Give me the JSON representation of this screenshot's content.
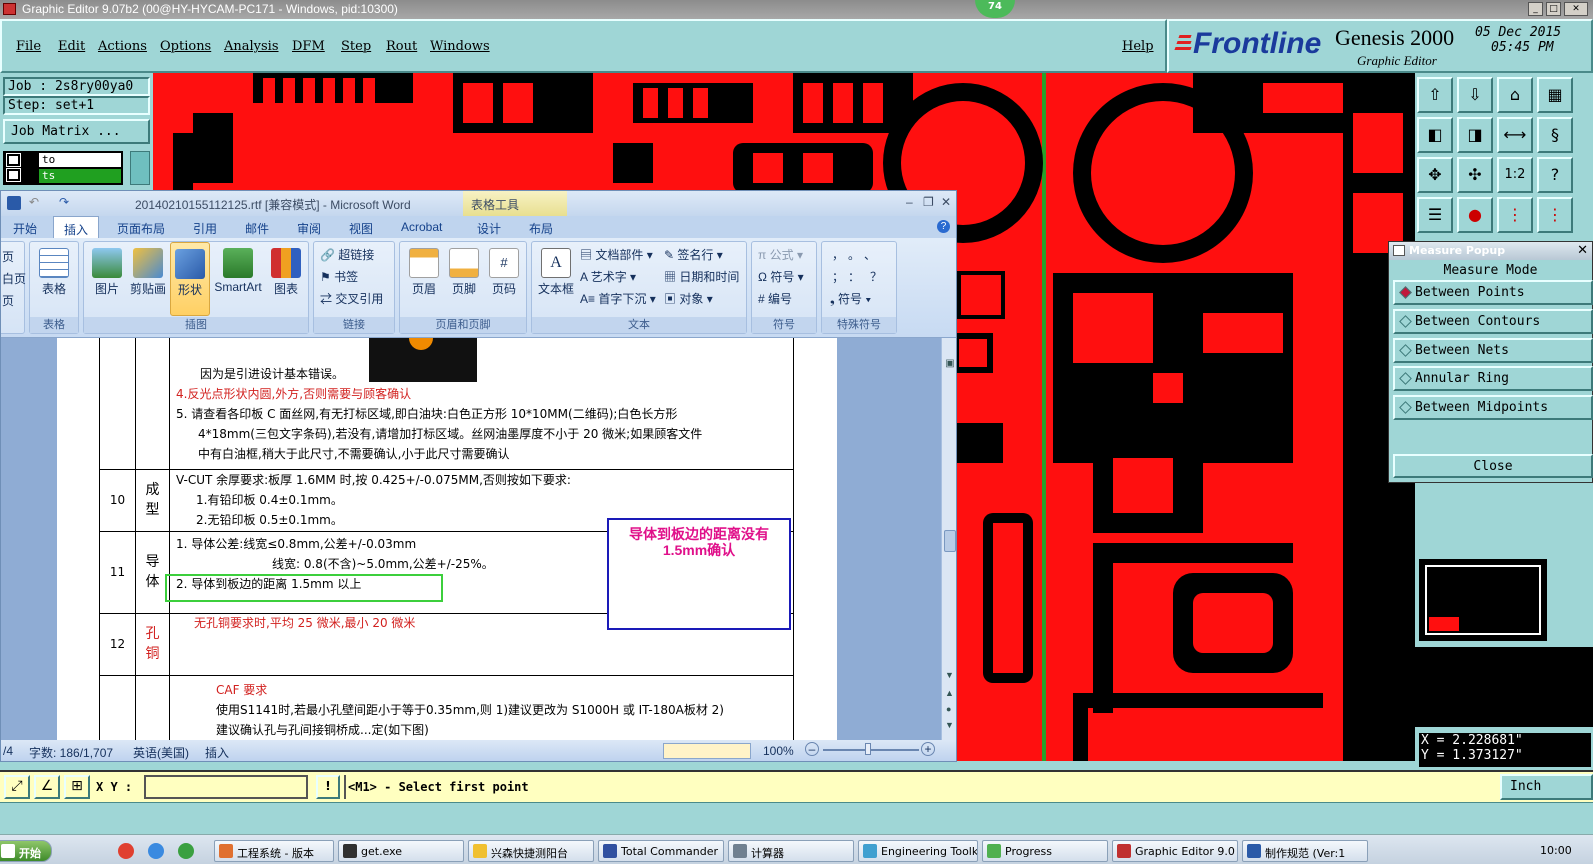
{
  "titlebar": {
    "title": "Graphic Editor 9.07b2 (00@HY-HYCAM-PC171 - Windows, pid:10300)",
    "badge": "74"
  },
  "menu": {
    "items": [
      "File",
      "Edit",
      "Actions",
      "Options",
      "Analysis",
      "DFM",
      "Step",
      "Rout",
      "Windows"
    ],
    "help": "Help"
  },
  "brand": {
    "logo": "Frontline",
    "product": "Genesis 2000",
    "subtitle": "Graphic Editor",
    "date": "05 Dec 2015",
    "time": "05:45 PM"
  },
  "job": {
    "job": "Job : 2s8ry00ya0",
    "step": "Step: set+1",
    "matrix_button": "Job Matrix ...",
    "layers": [
      "to",
      "ts"
    ]
  },
  "measure": {
    "title": "Measure Popup",
    "heading": "Measure Mode",
    "modes": [
      "Between Points",
      "Between Contours",
      "Between Nets",
      "Annular Ring",
      "Between Midpoints"
    ],
    "selected_mode": "Between Points",
    "close": "Close"
  },
  "coords": {
    "x": "X = 2.228681\"",
    "y": "Y = 1.373127\""
  },
  "command": {
    "xy_label": "X Y :",
    "xy_value": "",
    "prompt": "<M1> - Select first point",
    "units": "Inch"
  },
  "word": {
    "title": "20140210155112125.rtf [兼容模式] - Microsoft Word",
    "context_tools": "表格工具",
    "tabs": [
      "开始",
      "插入",
      "页面布局",
      "引用",
      "邮件",
      "审阅",
      "视图",
      "Acrobat",
      "设计",
      "布局"
    ],
    "active_tab": "插入",
    "groups": [
      "表格",
      "插图",
      "链接",
      "页眉和页脚",
      "文本",
      "符号",
      "特殊符号"
    ],
    "table_btn": "表格",
    "illus": [
      "图片",
      "剪贴画",
      "形状",
      "SmartArt",
      "图表"
    ],
    "links": [
      "超链接",
      "书签",
      "交叉引用"
    ],
    "hf": [
      "页眉",
      "页脚",
      "页码"
    ],
    "text_big": "文本框",
    "text_small": [
      "文档部件",
      "艺术字",
      "首字下沉",
      "签名行",
      "日期和时间",
      "对象"
    ],
    "symbols": [
      "公式",
      "符号",
      "编号"
    ],
    "special": [
      "，",
      "。",
      "、",
      "；",
      "：",
      "？",
      "符号"
    ],
    "left_cut": [
      "页",
      "白页",
      "页"
    ],
    "doc": {
      "row9_lines": [
        "因为是引进设计基本错误。",
        "4.反光点形状内圆,外方,否则需要与顾客确认",
        "5. 请查看各印板 C 面丝网,有无打标区域,即白油块:白色正方形 10*10MM(二维码);白色长方形",
        "4*18mm(三包文字条码),若没有,请增加打标区域。丝网油墨厚度不小于 20 微米;如果顾客文件",
        "中有白油框,稍大于此尺寸,不需要确认,小于此尺寸需要确认"
      ],
      "row10": {
        "num": "10",
        "name": "成型",
        "lines": [
          "V-CUT 余厚要求:板厚 1.6MM 时,按 0.425+/-0.075MM,否则按如下要求:",
          "1.有铅印板 0.4±0.1mm。",
          "2.无铅印板 0.5±0.1mm。"
        ]
      },
      "row11": {
        "num": "11",
        "name": "导体",
        "lines": [
          "1. 导体公差:线宽≤0.8mm,公差+/-0.03mm",
          "线宽: 0.8(不含)~5.0mm,公差+/-25%。",
          "2. 导体到板边的距离 1.5mm 以上"
        ]
      },
      "row12": {
        "num": "12",
        "name": "孔铜",
        "lines": [
          "无孔铜要求时,平均 25 微米,最小 20 微米"
        ]
      },
      "row13_lines": [
        "CAF 要求",
        "使用S1141时,若最小孔壁间距小于等于0.35mm,则 1)建议更改为 S1000H 或 IT-180A板材 2)",
        "建议确认孔与孔间接铜桥成...定(如下图)"
      ],
      "callout": "导体到板边的距离没有1.5mm确认"
    },
    "status": {
      "page": "/4",
      "words": "字数: 186/1,707",
      "lang": "英语(美国)",
      "mode": "插入",
      "zoom": "100%"
    }
  },
  "taskbar": {
    "start": "开始",
    "tasks": [
      "工程系统 - 版本",
      "get.exe",
      "兴森快捷测阳台",
      "Total Commander",
      "计算器",
      "Engineering Toolki",
      "Progress",
      "Graphic Editor 9.0",
      "制作规范 (Ver:1"
    ],
    "clock": "10:00"
  },
  "colors": {
    "canvas": "#ff0f0f",
    "panel": "#9fd6d6",
    "callout_border": "#1a1ab8",
    "callout_text": "#e0108a",
    "highlight": "#3ccf3c"
  }
}
